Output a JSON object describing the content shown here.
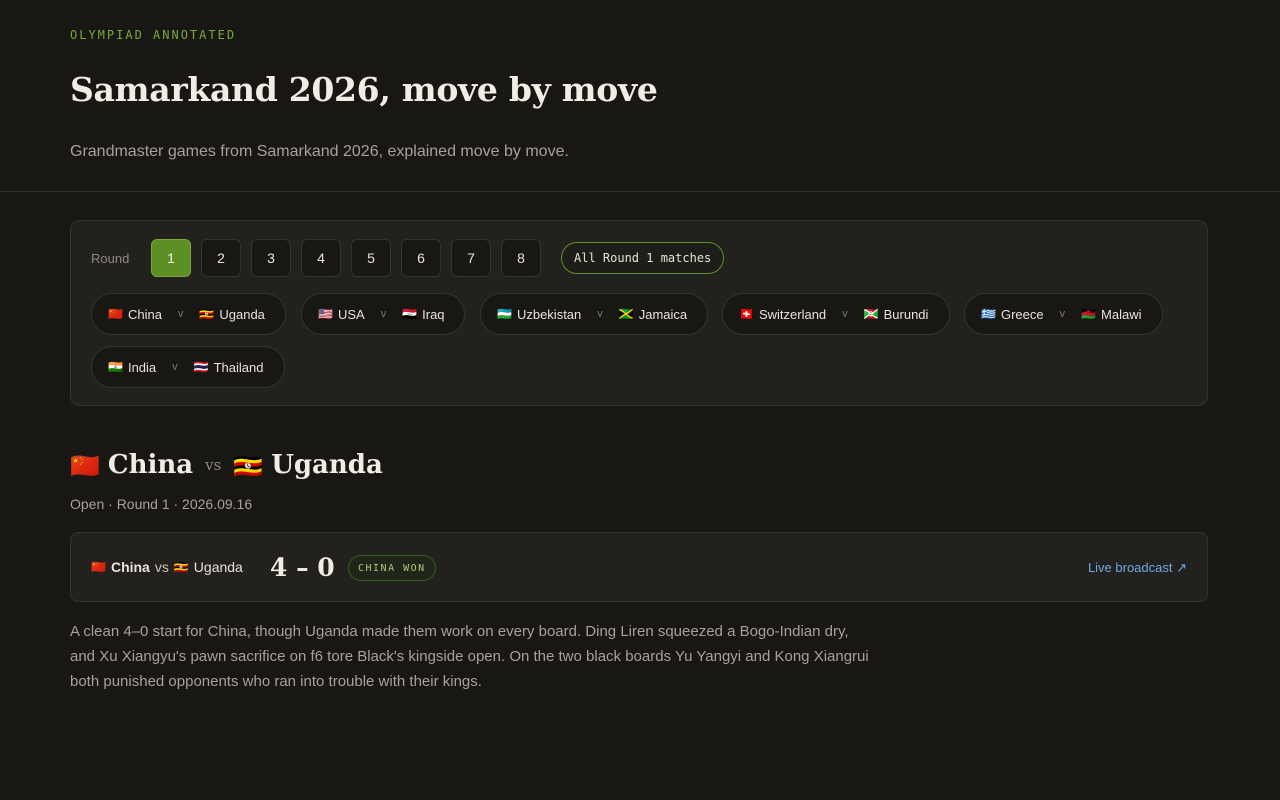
{
  "header": {
    "kicker": "OLYMPIAD ANNOTATED",
    "title": "Samarkand 2026, move by move",
    "subtitle": "Grandmaster games from Samarkand 2026, explained move by move."
  },
  "rounds": {
    "label": "Round",
    "items": [
      "1",
      "2",
      "3",
      "4",
      "5",
      "6",
      "7",
      "8"
    ],
    "active": "1",
    "all_matches_label": "All Round 1 matches"
  },
  "matches": [
    {
      "home": "China",
      "home_flag": "🇨🇳",
      "sep": "v",
      "away": "Uganda",
      "away_flag": "🇺🇬"
    },
    {
      "home": "USA",
      "home_flag": "🇺🇸",
      "sep": "v",
      "away": "Iraq",
      "away_flag": "🇮🇶"
    },
    {
      "home": "Uzbekistan",
      "home_flag": "🇺🇿",
      "sep": "v",
      "away": "Jamaica",
      "away_flag": "🇯🇲"
    },
    {
      "home": "Switzerland",
      "home_flag": "🇨🇭",
      "sep": "v",
      "away": "Burundi",
      "away_flag": "🇧🇮"
    },
    {
      "home": "Greece",
      "home_flag": "🇬🇷",
      "sep": "v",
      "away": "Malawi",
      "away_flag": "🇲🇼"
    },
    {
      "home": "India",
      "home_flag": "🇮🇳",
      "sep": "v",
      "away": "Thailand",
      "away_flag": "🇹🇭"
    }
  ],
  "game": {
    "home": "China",
    "home_flag": "🇨🇳",
    "vs": "vs",
    "away": "Uganda",
    "away_flag": "🇺🇬",
    "meta": "Open · Round 1 · 2026.09.16",
    "score": "4 – 0",
    "result_badge": "CHINA WON",
    "live_link": "Live broadcast ↗",
    "summary": "A clean 4–0 start for China, though Uganda made them work on every board. Ding Liren squeezed a Bogo-Indian dry, and Xu Xiangyu's pawn sacrifice on f6 tore Black's kingside open. On the two black boards Yu Yangyi and Kong Xiangrui both punished opponents who ran into trouble with their kings."
  },
  "colors": {
    "background": "#181714",
    "accent": "#7aa83c",
    "active_round": "#5d8f24",
    "link": "#6fa8e0"
  }
}
